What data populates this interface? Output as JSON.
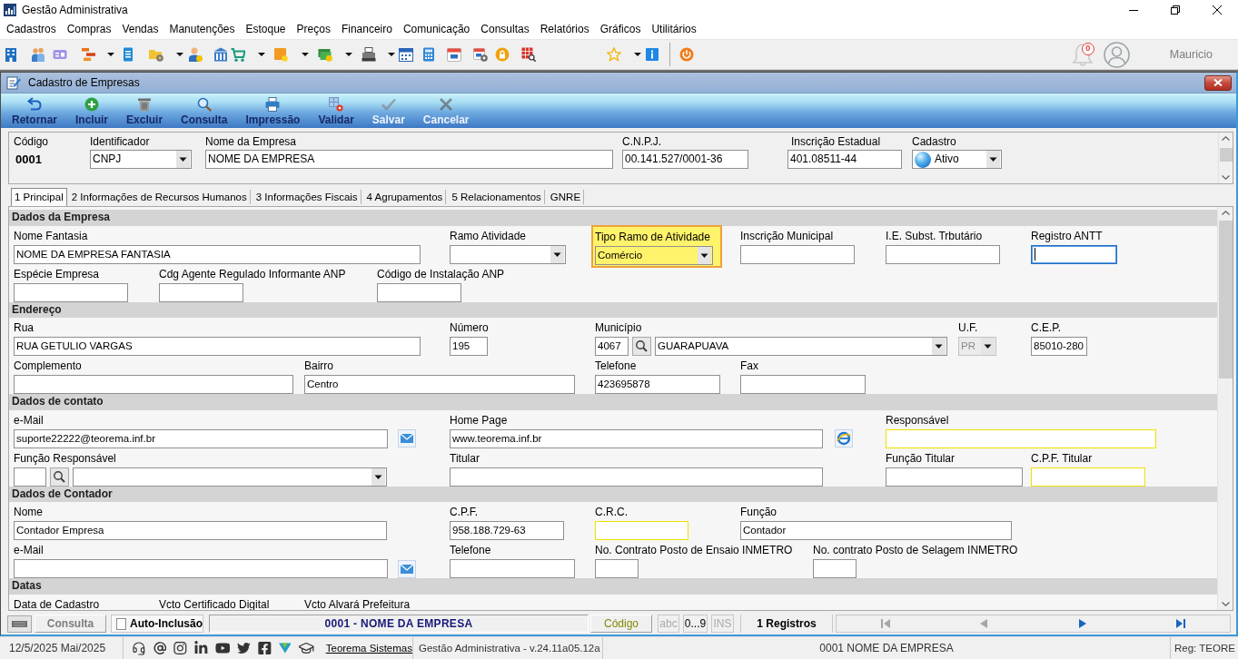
{
  "window": {
    "title": "Gestão Administrativa"
  },
  "menu": [
    "Cadastros",
    "Compras",
    "Vendas",
    "Manutenções",
    "Estoque",
    "Preços",
    "Financeiro",
    "Comunicação",
    "Consultas",
    "Relatórios",
    "Gráficos",
    "Utilitários"
  ],
  "toolbar": {
    "notifications": "0",
    "user": "Mauricio"
  },
  "form_window": {
    "title": "Cadastro de Empresas",
    "actions": [
      {
        "label": "Retornar",
        "disabled": false
      },
      {
        "label": "Incluir",
        "disabled": false
      },
      {
        "label": "Excluir",
        "disabled": false
      },
      {
        "label": "Consulta",
        "disabled": false
      },
      {
        "label": "Impressão",
        "disabled": false
      },
      {
        "label": "Validar",
        "disabled": false
      },
      {
        "label": "Salvar",
        "disabled": true
      },
      {
        "label": "Cancelar",
        "disabled": true
      }
    ]
  },
  "header": {
    "fields": [
      {
        "label": "Código",
        "kind": "display",
        "value": "0001"
      },
      {
        "label": "Identificador",
        "kind": "select",
        "value": "CNPJ"
      },
      {
        "label": "Nome da Empresa",
        "kind": "text",
        "value": "NOME DA EMPRESA"
      },
      {
        "label": "C.N.P.J.",
        "kind": "text",
        "value": "00.141.527/0001-36"
      },
      {
        "label": "Inscrição Estadual",
        "kind": "text",
        "value": "401.08511-44"
      },
      {
        "label": "Cadastro",
        "kind": "status",
        "value": "Ativo"
      }
    ]
  },
  "tabs": [
    {
      "label": "1 Principal",
      "selected": true
    },
    {
      "label": "2 Informações de Recursos Humanos",
      "selected": false
    },
    {
      "label": "3 Informações Fiscais",
      "selected": false
    },
    {
      "label": "4 Agrupamentos",
      "selected": false
    },
    {
      "label": "5 Relacionamentos",
      "selected": false
    },
    {
      "label": "GNRE",
      "selected": false
    }
  ],
  "form": {
    "sections": [
      {
        "title": "Dados da Empresa",
        "rows": [
          {
            "fields": [
              {
                "label": "Nome Fantasia",
                "kind": "text",
                "value": "NOME DA EMPRESA FANTASIA",
                "focused": false,
                "flagged": false,
                "disabled": false,
                "emphasized": false
              },
              {
                "label": "Ramo Atividade",
                "kind": "select",
                "focused": false,
                "flagged": false,
                "disabled": false,
                "emphasized": false
              },
              {
                "label": "Tipo Ramo de Atividade",
                "kind": "select",
                "value": "Comércio",
                "focused": false,
                "flagged": false,
                "disabled": false,
                "emphasized": true
              },
              {
                "label": "Inscrição Municipal",
                "kind": "text",
                "focused": false,
                "flagged": false,
                "disabled": false,
                "emphasized": false
              },
              {
                "label": "I.E. Subst. Trbutário",
                "kind": "text",
                "focused": false,
                "flagged": false,
                "disabled": false,
                "emphasized": false
              },
              {
                "label": "Registro ANTT",
                "kind": "text",
                "focused": true,
                "flagged": false,
                "disabled": false,
                "emphasized": false
              }
            ]
          },
          {
            "fields": [
              {
                "label": "Espécie Empresa",
                "kind": "text",
                "focused": false,
                "flagged": false,
                "disabled": false,
                "emphasized": false
              },
              {
                "label": "Cdg Agente Regulado Informante ANP",
                "kind": "text",
                "focused": false,
                "flagged": false,
                "disabled": false,
                "emphasized": false
              },
              {
                "label": "Código de Instalação ANP",
                "kind": "text",
                "focused": false,
                "flagged": false,
                "disabled": false,
                "emphasized": false
              }
            ]
          }
        ]
      },
      {
        "title": "Endereço",
        "rows": [
          {
            "fields": [
              {
                "label": "Rua",
                "kind": "text",
                "value": "RUA GETULIO VARGAS",
                "focused": false,
                "flagged": false,
                "disabled": false,
                "emphasized": false
              },
              {
                "label": "Número",
                "kind": "text",
                "value": "195",
                "focused": false,
                "flagged": false,
                "disabled": false,
                "emphasized": false
              },
              {
                "label": "Município",
                "kind": "lookup",
                "code": "4067",
                "value": "GUARAPUAVA",
                "focused": false,
                "flagged": false,
                "disabled": false,
                "emphasized": false
              },
              {
                "label": "U.F.",
                "kind": "select",
                "value": "PR",
                "focused": false,
                "flagged": false,
                "disabled": true,
                "emphasized": false
              },
              {
                "label": "C.E.P.",
                "kind": "text",
                "value": "85010-280",
                "focused": false,
                "flagged": false,
                "disabled": false,
                "emphasized": false
              }
            ]
          },
          {
            "fields": [
              {
                "label": "Complemento",
                "kind": "text",
                "focused": false,
                "flagged": false,
                "disabled": false,
                "emphasized": false
              },
              {
                "label": "Bairro",
                "kind": "text",
                "value": "Centro",
                "focused": false,
                "flagged": false,
                "disabled": false,
                "emphasized": false
              },
              {
                "label": "Telefone",
                "kind": "text",
                "value": "423695878",
                "focused": false,
                "flagged": false,
                "disabled": false,
                "emphasized": false
              },
              {
                "label": "Fax",
                "kind": "text",
                "focused": false,
                "flagged": false,
                "disabled": false,
                "emphasized": false
              }
            ]
          }
        ]
      },
      {
        "title": "Dados de contato",
        "rows": [
          {
            "fields": [
              {
                "label": "e-Mail",
                "kind": "email",
                "value": "suporte22222@teorema.inf.br",
                "focused": false,
                "flagged": false,
                "disabled": false,
                "emphasized": false
              },
              {
                "label": "Home Page",
                "kind": "url",
                "value": "www.teorema.inf.br",
                "focused": false,
                "flagged": false,
                "disabled": false,
                "emphasized": false
              },
              {
                "label": "Responsável",
                "kind": "text",
                "focused": false,
                "flagged": true,
                "disabled": false,
                "emphasized": false
              }
            ]
          },
          {
            "fields": [
              {
                "label": "Função Responsável",
                "kind": "lookup",
                "focused": false,
                "flagged": false,
                "disabled": false,
                "emphasized": false
              },
              {
                "label": "Titular",
                "kind": "text",
                "focused": false,
                "flagged": false,
                "disabled": false,
                "emphasized": false
              },
              {
                "label": "Função Titular",
                "kind": "text",
                "focused": false,
                "flagged": false,
                "disabled": false,
                "emphasized": false
              },
              {
                "label": "C.P.F. Titular",
                "kind": "text",
                "focused": false,
                "flagged": true,
                "disabled": false,
                "emphasized": false
              }
            ]
          }
        ]
      },
      {
        "title": "Dados de Contador",
        "rows": [
          {
            "fields": [
              {
                "label": "Nome",
                "kind": "text",
                "value": "Contador Empresa",
                "focused": false,
                "flagged": false,
                "disabled": false,
                "emphasized": false
              },
              {
                "label": "C.P.F.",
                "kind": "text",
                "value": "958.188.729-63",
                "focused": false,
                "flagged": false,
                "disabled": false,
                "emphasized": false
              },
              {
                "label": "C.R.C.",
                "kind": "text",
                "focused": false,
                "flagged": true,
                "disabled": false,
                "emphasized": false
              },
              {
                "label": "Função",
                "kind": "text",
                "value": "Contador",
                "focused": false,
                "flagged": false,
                "disabled": false,
                "emphasized": false
              }
            ]
          },
          {
            "fields": [
              {
                "label": "e-Mail",
                "kind": "email",
                "focused": false,
                "flagged": false,
                "disabled": false,
                "emphasized": false
              },
              {
                "label": "Telefone",
                "kind": "text",
                "focused": false,
                "flagged": false,
                "disabled": false,
                "emphasized": false
              },
              {
                "label": "No. Contrato Posto de Ensaio INMETRO",
                "kind": "text",
                "focused": false,
                "flagged": false,
                "disabled": false,
                "emphasized": false
              },
              {
                "label": "No. contrato Posto de Selagem INMETRO",
                "kind": "text",
                "focused": false,
                "flagged": false,
                "disabled": false,
                "emphasized": false
              }
            ]
          }
        ]
      },
      {
        "title": "Datas",
        "rows": [
          {
            "fields": [
              {
                "label": "Data de Cadastro",
                "kind": "cutoff"
              },
              {
                "label": "Vcto Certificado Digital",
                "kind": "cutoff"
              },
              {
                "label": "Vcto Alvará Prefeitura",
                "kind": "cutoff"
              }
            ]
          }
        ]
      }
    ]
  },
  "nav_bar": {
    "mode": "Consulta",
    "auto_inclusion": {
      "label": "Auto-Inclusão",
      "checked": false
    },
    "record": "0001 - NOME DA EMPRESA",
    "order": "Código",
    "indicators": [
      {
        "label": "abc",
        "on": false
      },
      {
        "label": "0...9",
        "on": true
      },
      {
        "label": "INS",
        "on": false
      }
    ],
    "count": "1 Registros",
    "navigation": [
      {
        "kind": "first",
        "disabled": true
      },
      {
        "kind": "previous",
        "disabled": true
      },
      {
        "kind": "next",
        "disabled": false
      },
      {
        "kind": "last",
        "disabled": false
      }
    ]
  },
  "status_bar": {
    "date": "12/5/2025 Mai/2025",
    "link": "Teorema Sistemas",
    "version": "Gestão Administrativa - v.24.11a05.12a",
    "record": "0001 NOME DA EMPRESA",
    "registration": "Reg: TEORE"
  }
}
